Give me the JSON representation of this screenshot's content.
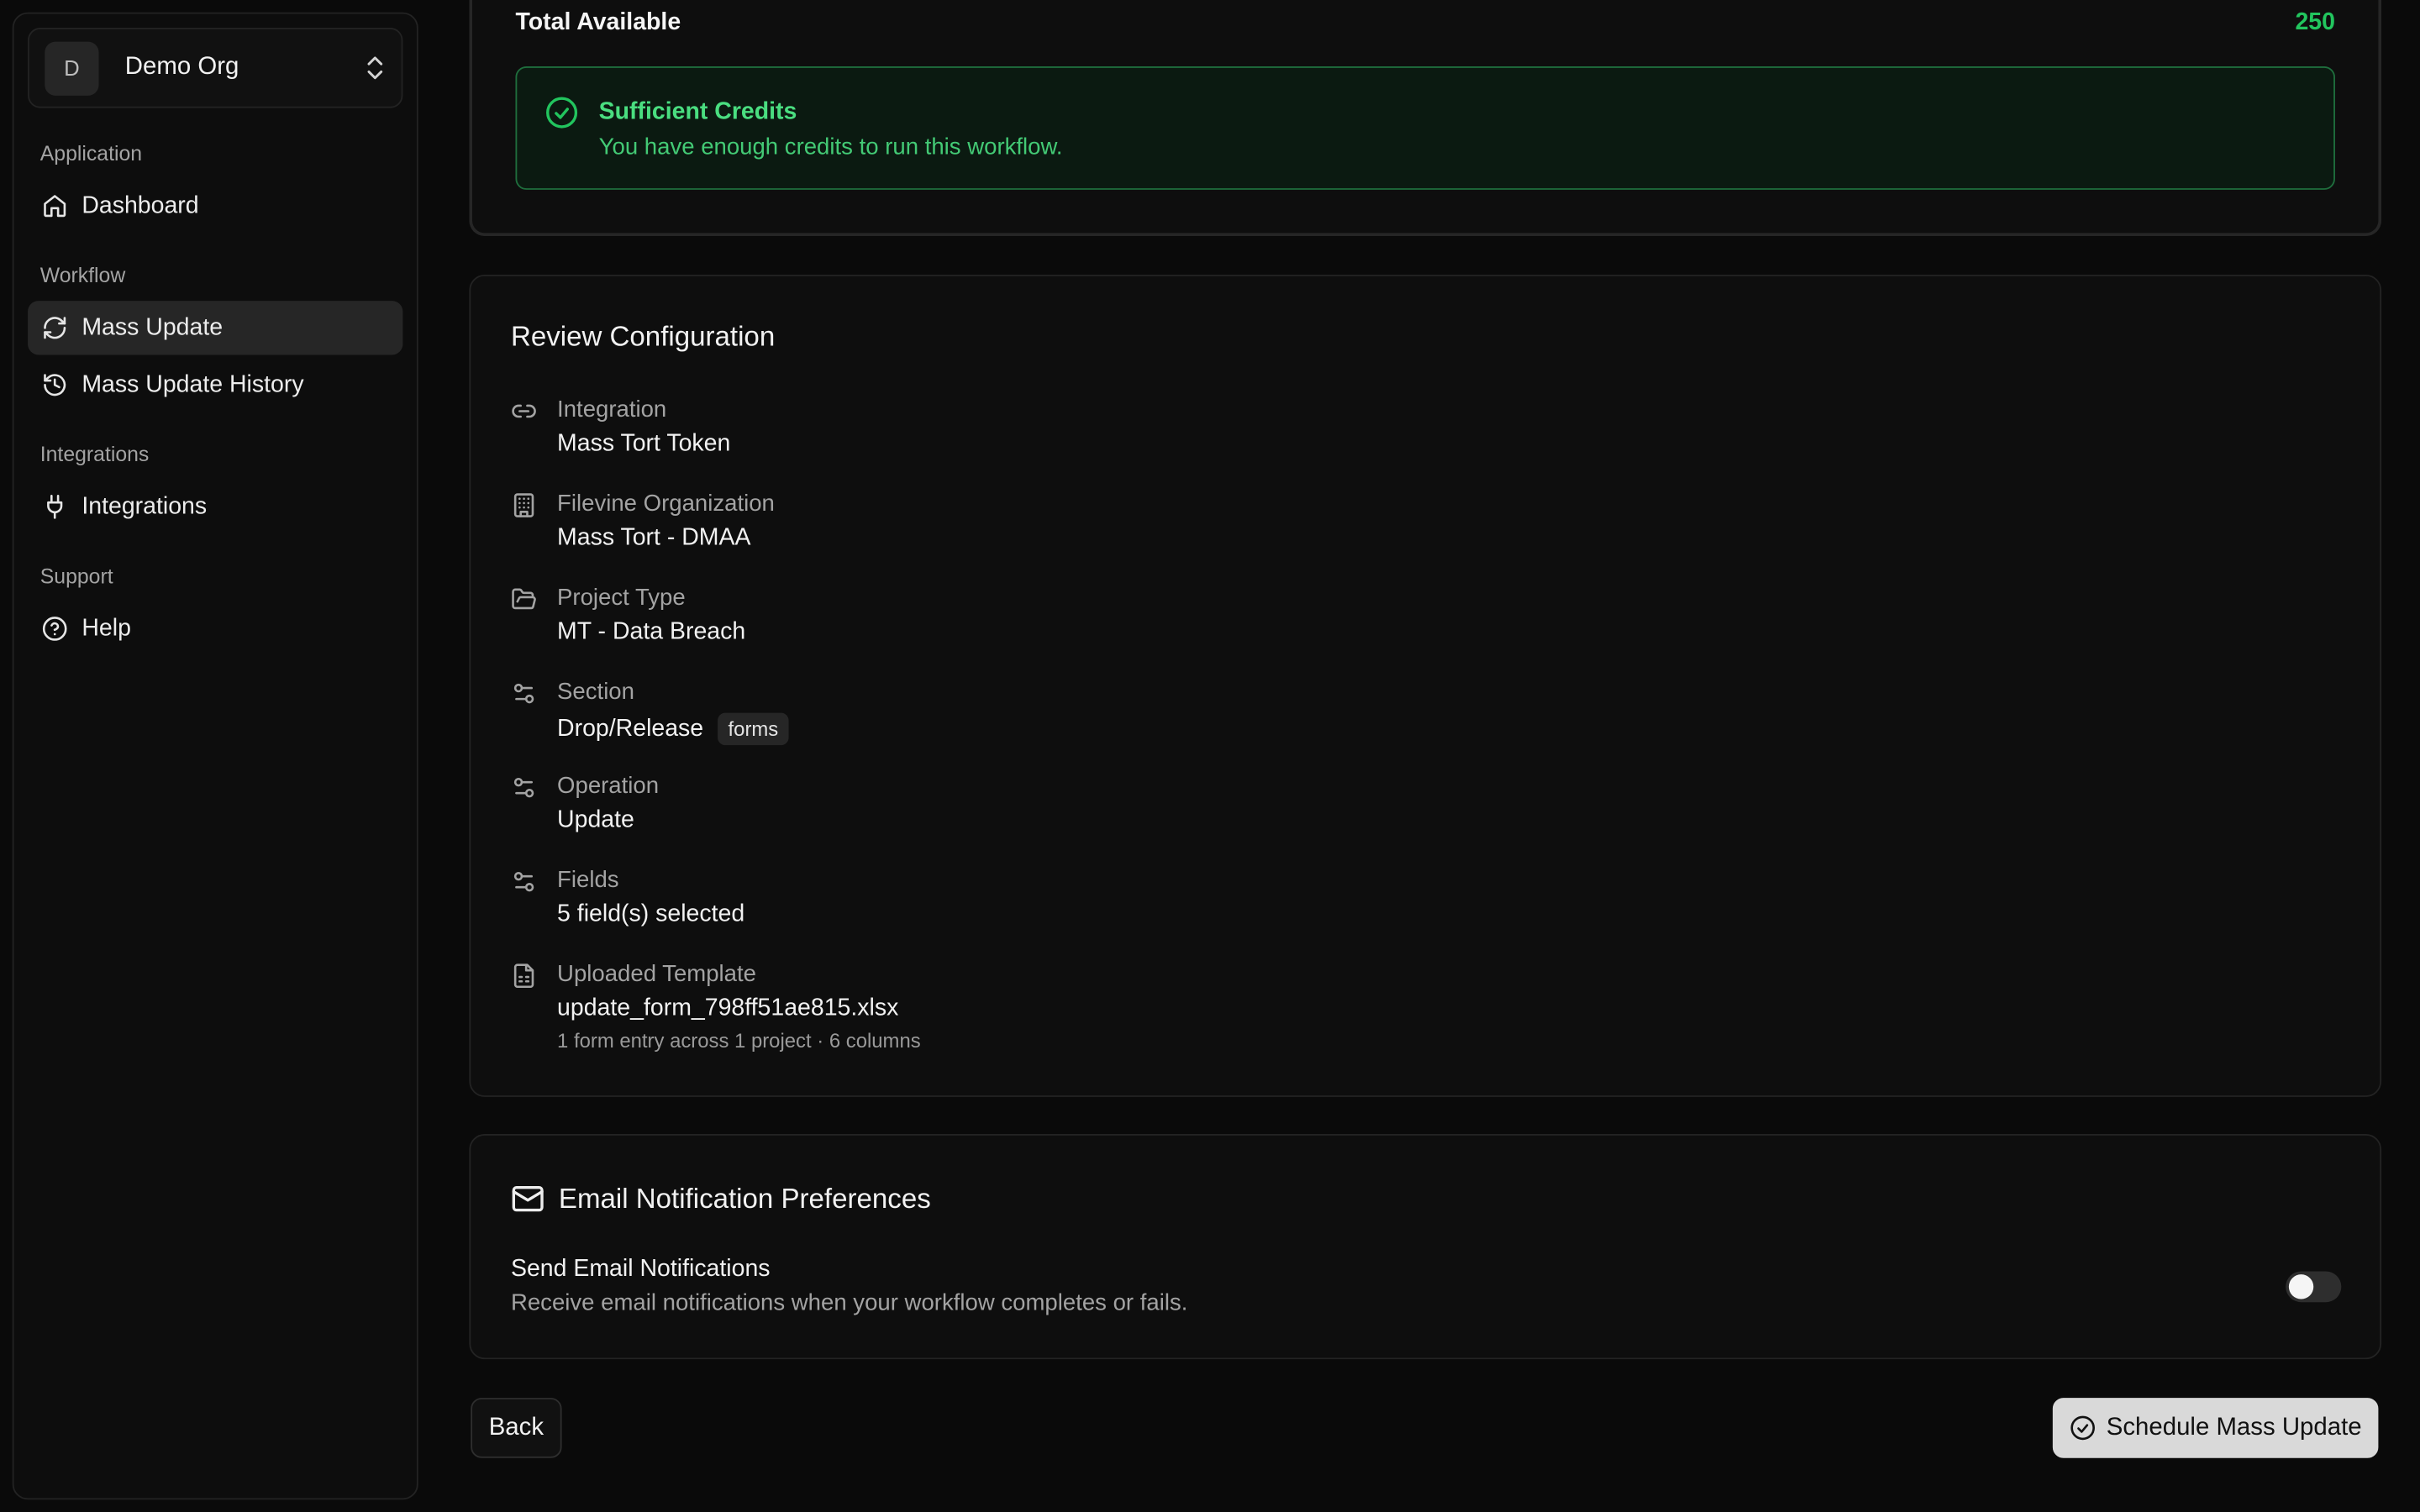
{
  "sidebar": {
    "org": {
      "avatar": "D",
      "name": "Demo Org",
      "icon": "chevrons-up-down-icon"
    },
    "groups": [
      {
        "label": "Application",
        "items": [
          {
            "label": "Dashboard",
            "icon": "home-icon",
            "active": false
          }
        ]
      },
      {
        "label": "Workflow",
        "items": [
          {
            "label": "Mass Update",
            "icon": "refresh-icon",
            "active": true
          },
          {
            "label": "Mass Update History",
            "icon": "history-icon",
            "active": false
          }
        ]
      },
      {
        "label": "Integrations",
        "items": [
          {
            "label": "Integrations",
            "icon": "plug-icon",
            "active": false
          }
        ]
      },
      {
        "label": "Support",
        "items": [
          {
            "label": "Help",
            "icon": "help-circle-icon",
            "active": false
          }
        ]
      }
    ]
  },
  "credits": {
    "total_label": "Total Available",
    "total_value": "250",
    "alert_title": "Sufficient Credits",
    "alert_desc": "You have enough credits to run this workflow.",
    "accent": "#22c55e"
  },
  "review": {
    "title": "Review Configuration",
    "items": [
      {
        "label": "Integration",
        "value": "Mass Tort Token",
        "icon": "link-icon"
      },
      {
        "label": "Filevine Organization",
        "value": "Mass Tort - DMAA",
        "icon": "building-icon"
      },
      {
        "label": "Project Type",
        "value": "MT - Data Breach",
        "icon": "folder-open-icon"
      },
      {
        "label": "Section",
        "value": "Drop/Release",
        "badge": "forms",
        "icon": "sliders-icon"
      },
      {
        "label": "Operation",
        "value": "Update",
        "icon": "sliders-icon"
      },
      {
        "label": "Fields",
        "value": "5 field(s) selected",
        "icon": "sliders-icon"
      },
      {
        "label": "Uploaded Template",
        "value": "update_form_798ff51ae815.xlsx",
        "meta": "1 form entry across 1 project · 6 columns",
        "icon": "file-spreadsheet-icon"
      }
    ]
  },
  "email": {
    "title": "Email Notification Preferences",
    "icon": "mail-icon",
    "label": "Send Email Notifications",
    "desc": "Receive email notifications when your workflow completes or fails.",
    "enabled": false
  },
  "actions": {
    "back_label": "Back",
    "schedule_label": "Schedule Mass Update"
  }
}
